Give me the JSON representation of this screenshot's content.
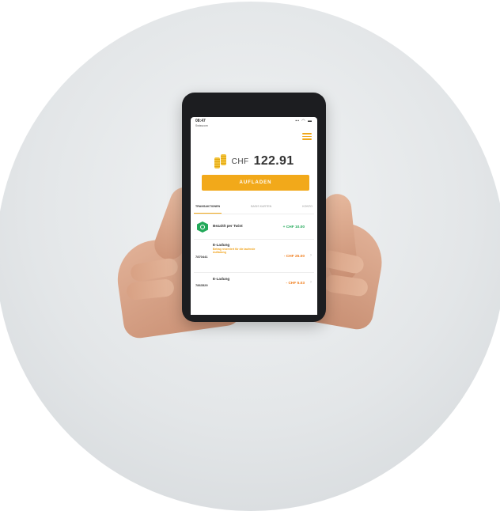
{
  "status": {
    "time": "08:47",
    "carrier": "Swisscom"
  },
  "balance": {
    "currency": "CHF",
    "amount": "122.91"
  },
  "topup_label": "AUFLADEN",
  "tabs": [
    {
      "label": "TRANSAKTIONEN",
      "active": true
    },
    {
      "label": "BASIS KARTEN",
      "active": false
    },
    {
      "label": "KONTO",
      "active": false
    }
  ],
  "transactions": [
    {
      "code": "",
      "title": "Bezahlt per Twint",
      "date": "",
      "amount": "+ CHF 10.00",
      "type": "plus"
    },
    {
      "code": "7870441",
      "title": "E-Ladung",
      "date": "",
      "info": "",
      "warning": "Betrag reserviert für die laufende Aufladung",
      "amount": "- CHF 25.00",
      "type": "minus"
    },
    {
      "code": "7863529",
      "title": "E-Ladung",
      "date": "",
      "amount": "- CHF 5.03",
      "type": "minus"
    }
  ],
  "colors": {
    "accent": "#f2a91a",
    "positive": "#23a95a",
    "negative": "#f07c1a"
  }
}
